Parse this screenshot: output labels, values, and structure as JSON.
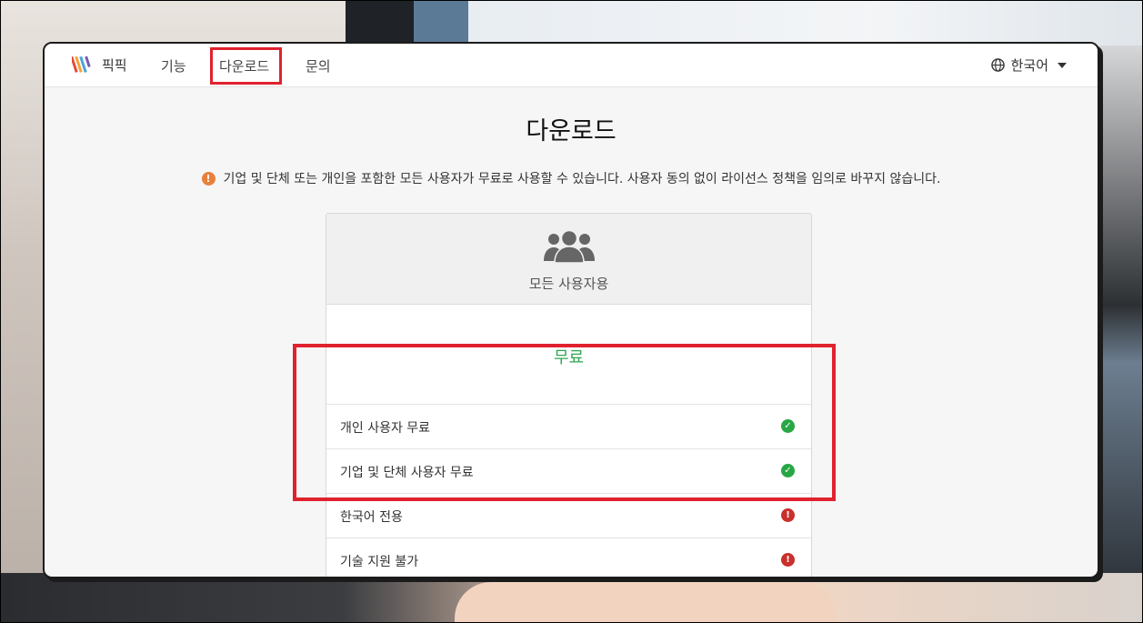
{
  "navbar": {
    "brand": "픽픽",
    "items": [
      "기능",
      "다운로드",
      "문의"
    ],
    "language": "한국어"
  },
  "page": {
    "title": "다운로드",
    "notice": "기업 및 단체 또는 개인을 포함한 모든 사용자가 무료로 사용할 수 있습니다. 사용자 동의 없이 라이선스 정책을 임의로 바꾸지 않습니다."
  },
  "plan": {
    "icon": "users-icon",
    "subtitle": "모든 사용자용",
    "price": "무료",
    "features": [
      {
        "label": "개인 사용자 무료",
        "status": "check"
      },
      {
        "label": "기업 및 단체 사용자 무료",
        "status": "check"
      },
      {
        "label": "한국어 전용",
        "status": "warning"
      },
      {
        "label": "기술 지원 불가",
        "status": "warning"
      }
    ]
  },
  "colors": {
    "accent_free": "#2fa84f",
    "check": "#28a745",
    "warning": "#c9302c",
    "highlight": "#e0222e",
    "notice_icon": "#e8803a"
  }
}
